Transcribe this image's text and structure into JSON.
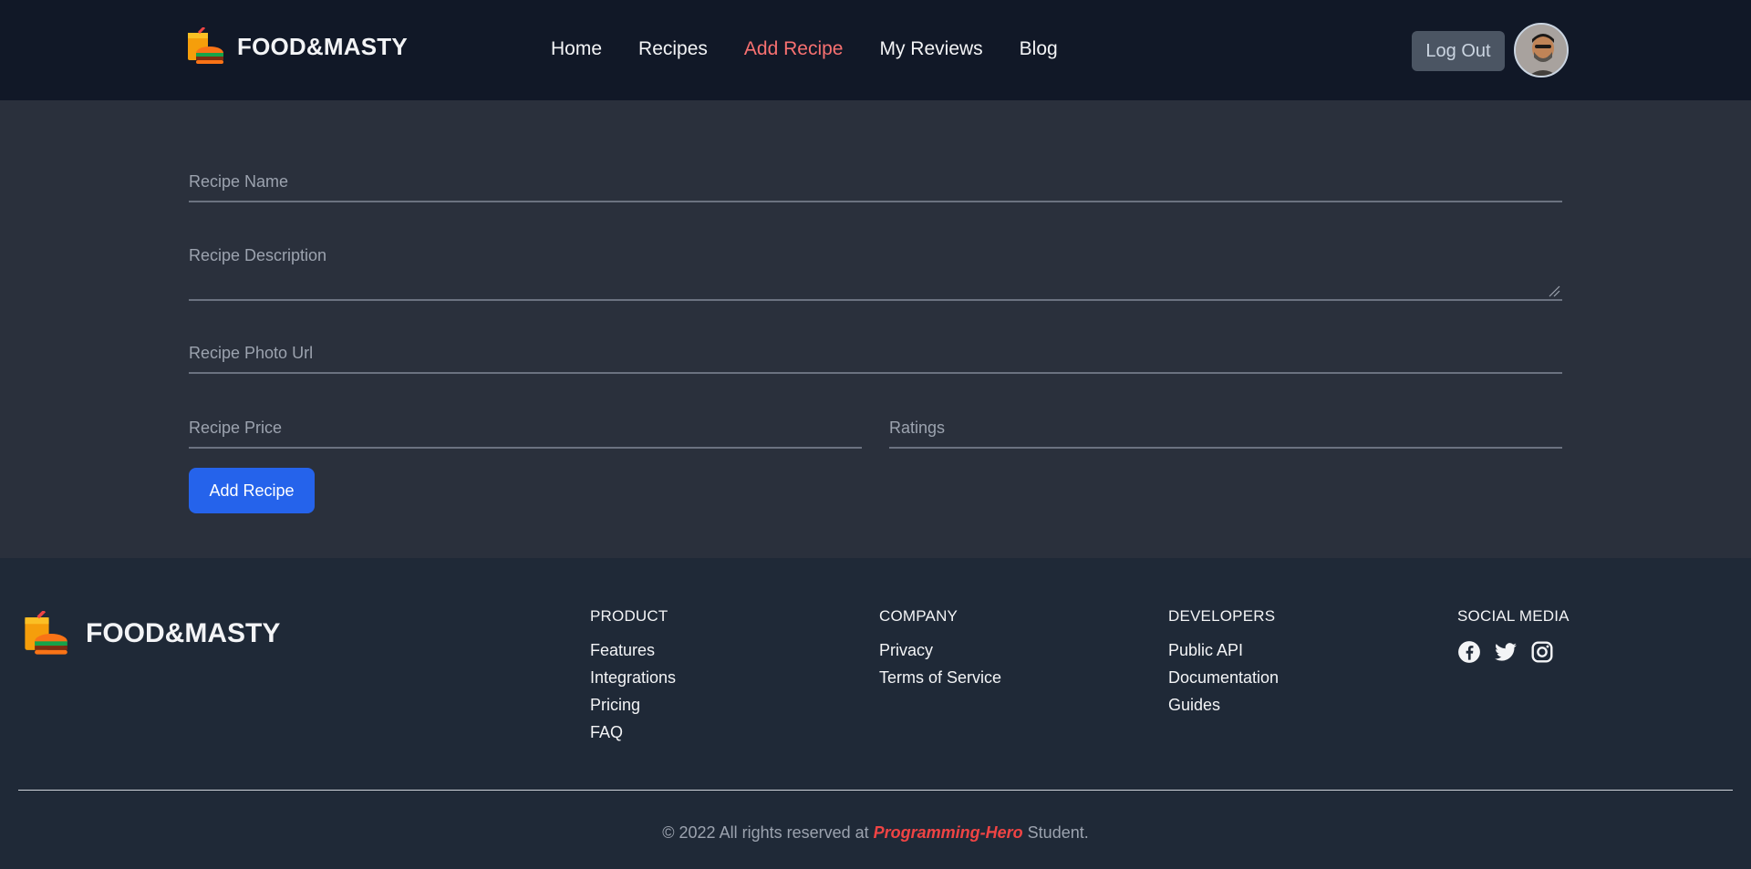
{
  "header": {
    "brand": "FOOD&MASTY",
    "nav": [
      {
        "label": "Home",
        "active": false
      },
      {
        "label": "Recipes",
        "active": false
      },
      {
        "label": "Add Recipe",
        "active": true
      },
      {
        "label": "My Reviews",
        "active": false
      },
      {
        "label": "Blog",
        "active": false
      }
    ],
    "logout_label": "Log Out"
  },
  "form": {
    "name_placeholder": "Recipe Name",
    "description_placeholder": "Recipe Description",
    "photo_placeholder": "Recipe Photo Url",
    "price_placeholder": "Recipe Price",
    "ratings_placeholder": "Ratings",
    "submit_label": "Add Recipe"
  },
  "footer": {
    "brand": "FOOD&MASTY",
    "columns": [
      {
        "title": "PRODUCT",
        "links": [
          "Features",
          "Integrations",
          "Pricing",
          "FAQ"
        ]
      },
      {
        "title": "COMPANY",
        "links": [
          "Privacy",
          "Terms of Service"
        ]
      },
      {
        "title": "DEVELOPERS",
        "links": [
          "Public API",
          "Documentation",
          "Guides"
        ]
      }
    ],
    "social": {
      "title": "SOCIAL MEDIA",
      "icons": [
        "facebook-icon",
        "twitter-icon",
        "instagram-icon"
      ]
    },
    "copyright": {
      "prefix": "© 2022 All rights reserved at ",
      "highlight": "Programming-Hero",
      "suffix": " Student."
    }
  },
  "colors": {
    "accent": "#f87171",
    "button": "#2563eb",
    "header_bg": "#111827",
    "footer_bg": "#1f2937",
    "body_bg": "#2a303c"
  }
}
